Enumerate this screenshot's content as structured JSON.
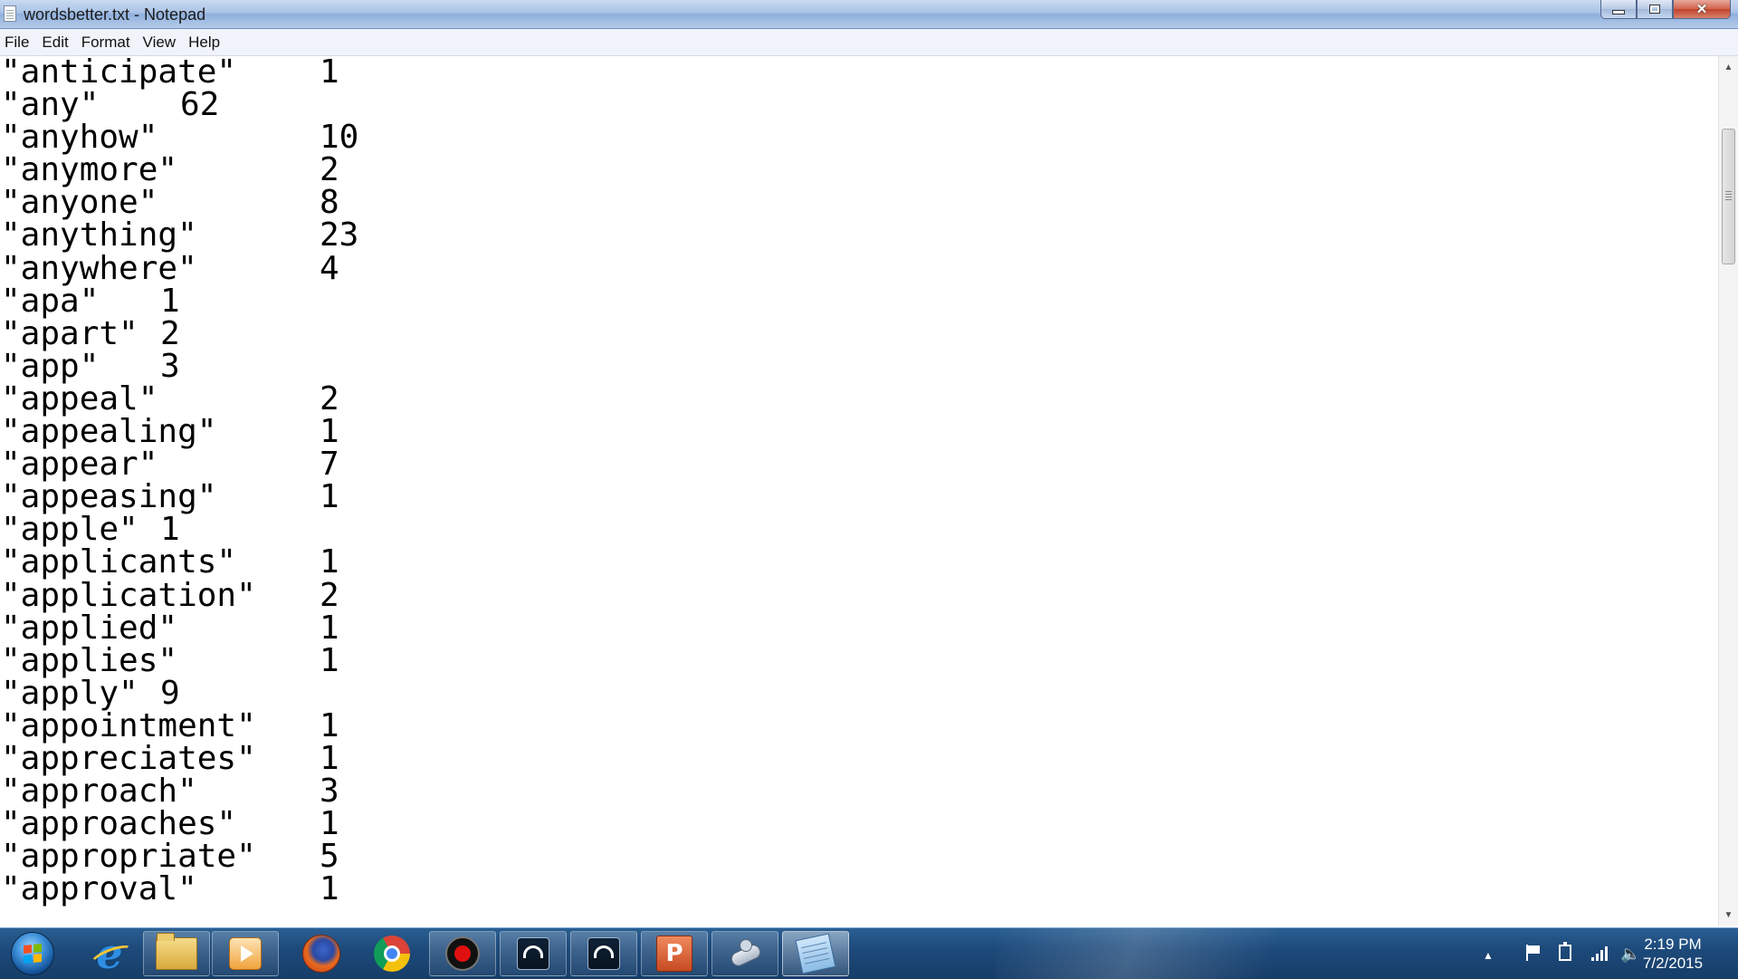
{
  "window": {
    "title": "wordsbetter.txt - Notepad",
    "minimize_glyph": "",
    "close_glyph": "✕"
  },
  "menubar": {
    "items": [
      "File",
      "Edit",
      "Format",
      "View",
      "Help"
    ]
  },
  "editor": {
    "lines": [
      {
        "word": "\"anticipate\"",
        "count": "1",
        "col": "long"
      },
      {
        "word": "\"any\"",
        "count": "62",
        "col": "mid"
      },
      {
        "word": "\"anyhow\"",
        "count": "10",
        "col": "long"
      },
      {
        "word": "\"anymore\"",
        "count": "2",
        "col": "long"
      },
      {
        "word": "\"anyone\"",
        "count": "8",
        "col": "long"
      },
      {
        "word": "\"anything\"",
        "count": "23",
        "col": "long"
      },
      {
        "word": "\"anywhere\"",
        "count": "4",
        "col": "long"
      },
      {
        "word": "\"apa\"",
        "count": "1",
        "col": "short"
      },
      {
        "word": "\"apart\"",
        "count": "2",
        "col": "short"
      },
      {
        "word": "\"app\"",
        "count": "3",
        "col": "short"
      },
      {
        "word": "\"appeal\"",
        "count": "2",
        "col": "long"
      },
      {
        "word": "\"appealing\"",
        "count": "1",
        "col": "long"
      },
      {
        "word": "\"appear\"",
        "count": "7",
        "col": "long"
      },
      {
        "word": "\"appeasing\"",
        "count": "1",
        "col": "long"
      },
      {
        "word": "\"apple\"",
        "count": "1",
        "col": "short"
      },
      {
        "word": "\"applicants\"",
        "count": "1",
        "col": "long"
      },
      {
        "word": "\"application\"",
        "count": "2",
        "col": "long"
      },
      {
        "word": "\"applied\"",
        "count": "1",
        "col": "long"
      },
      {
        "word": "\"applies\"",
        "count": "1",
        "col": "long"
      },
      {
        "word": "\"apply\"",
        "count": "9",
        "col": "short"
      },
      {
        "word": "\"appointment\"",
        "count": "1",
        "col": "long"
      },
      {
        "word": "\"appreciates\"",
        "count": "1",
        "col": "long"
      },
      {
        "word": "\"approach\"",
        "count": "3",
        "col": "long"
      },
      {
        "word": "\"approaches\"",
        "count": "1",
        "col": "long"
      },
      {
        "word": "\"appropriate\"",
        "count": "5",
        "col": "long"
      },
      {
        "word": "\"approval\"",
        "count": "1",
        "col": "long"
      }
    ]
  },
  "scrollbar": {
    "up_arrow": "▲",
    "down_arrow": "▼"
  },
  "taskbar": {
    "apps": [
      {
        "name": "internet-explorer",
        "glyph": "e"
      },
      {
        "name": "file-explorer",
        "glyph": ""
      },
      {
        "name": "media-player",
        "glyph": ""
      },
      {
        "name": "firefox",
        "glyph": ""
      },
      {
        "name": "chrome",
        "glyph": ""
      },
      {
        "name": "screen-recorder",
        "glyph": ""
      },
      {
        "name": "app-1",
        "glyph": ""
      },
      {
        "name": "app-2",
        "glyph": ""
      },
      {
        "name": "powerpoint",
        "glyph": "P"
      },
      {
        "name": "snipping-tool",
        "glyph": ""
      },
      {
        "name": "notepad",
        "glyph": ""
      }
    ],
    "tray": {
      "show_hidden_glyph": "▲",
      "volume_glyph": "🔈"
    },
    "clock": {
      "time": "2:19 PM",
      "date": "7/2/2015"
    }
  }
}
